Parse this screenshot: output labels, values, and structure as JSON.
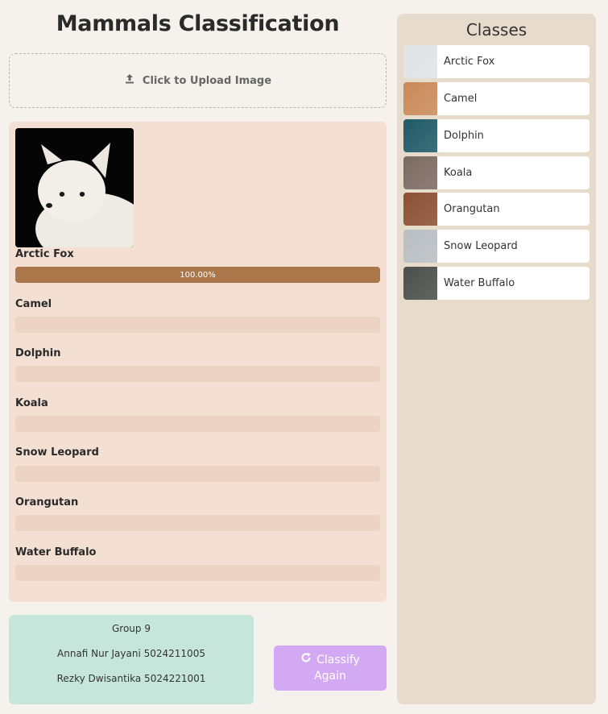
{
  "header": {
    "title": "Mammals Classification"
  },
  "upload": {
    "label": "Click to Upload Image",
    "icon": "upload-icon"
  },
  "prediction": {
    "top_label": "Arctic Fox",
    "top_percent_text": "100.00%",
    "top_fraction": 1.0,
    "others": [
      {
        "label": "Camel",
        "fraction": 0
      },
      {
        "label": "Dolphin",
        "fraction": 0
      },
      {
        "label": "Koala",
        "fraction": 0
      },
      {
        "label": "Snow Leopard",
        "fraction": 0
      },
      {
        "label": "Orangutan",
        "fraction": 0
      },
      {
        "label": "Water Buffalo",
        "fraction": 0
      }
    ]
  },
  "footer": {
    "group": "Group 9",
    "member1": "Annafi Nur Jayani 5024211005",
    "member2": "Rezky Dwisantika 5024221001"
  },
  "classify_button": {
    "line1": "Classify",
    "line2": "Again",
    "icon": "refresh-icon"
  },
  "sidebar": {
    "title": "Classes",
    "items": [
      {
        "label": "Arctic Fox",
        "color": "#dfe3e6"
      },
      {
        "label": "Camel",
        "color": "#c98a5a"
      },
      {
        "label": "Dolphin",
        "color": "#1f5a66"
      },
      {
        "label": "Koala",
        "color": "#7c6a62"
      },
      {
        "label": "Orangutan",
        "color": "#8a5034"
      },
      {
        "label": "Snow Leopard",
        "color": "#b9bec2"
      },
      {
        "label": "Water Buffalo",
        "color": "#4a4f4c"
      }
    ]
  },
  "colors": {
    "accent_bar": "#a9774a",
    "results_bg": "#f3e0d3",
    "button_bg": "#d4a9f4",
    "footer_bg": "#c6e6dc",
    "sidebar_bg": "#e7dbcc"
  }
}
